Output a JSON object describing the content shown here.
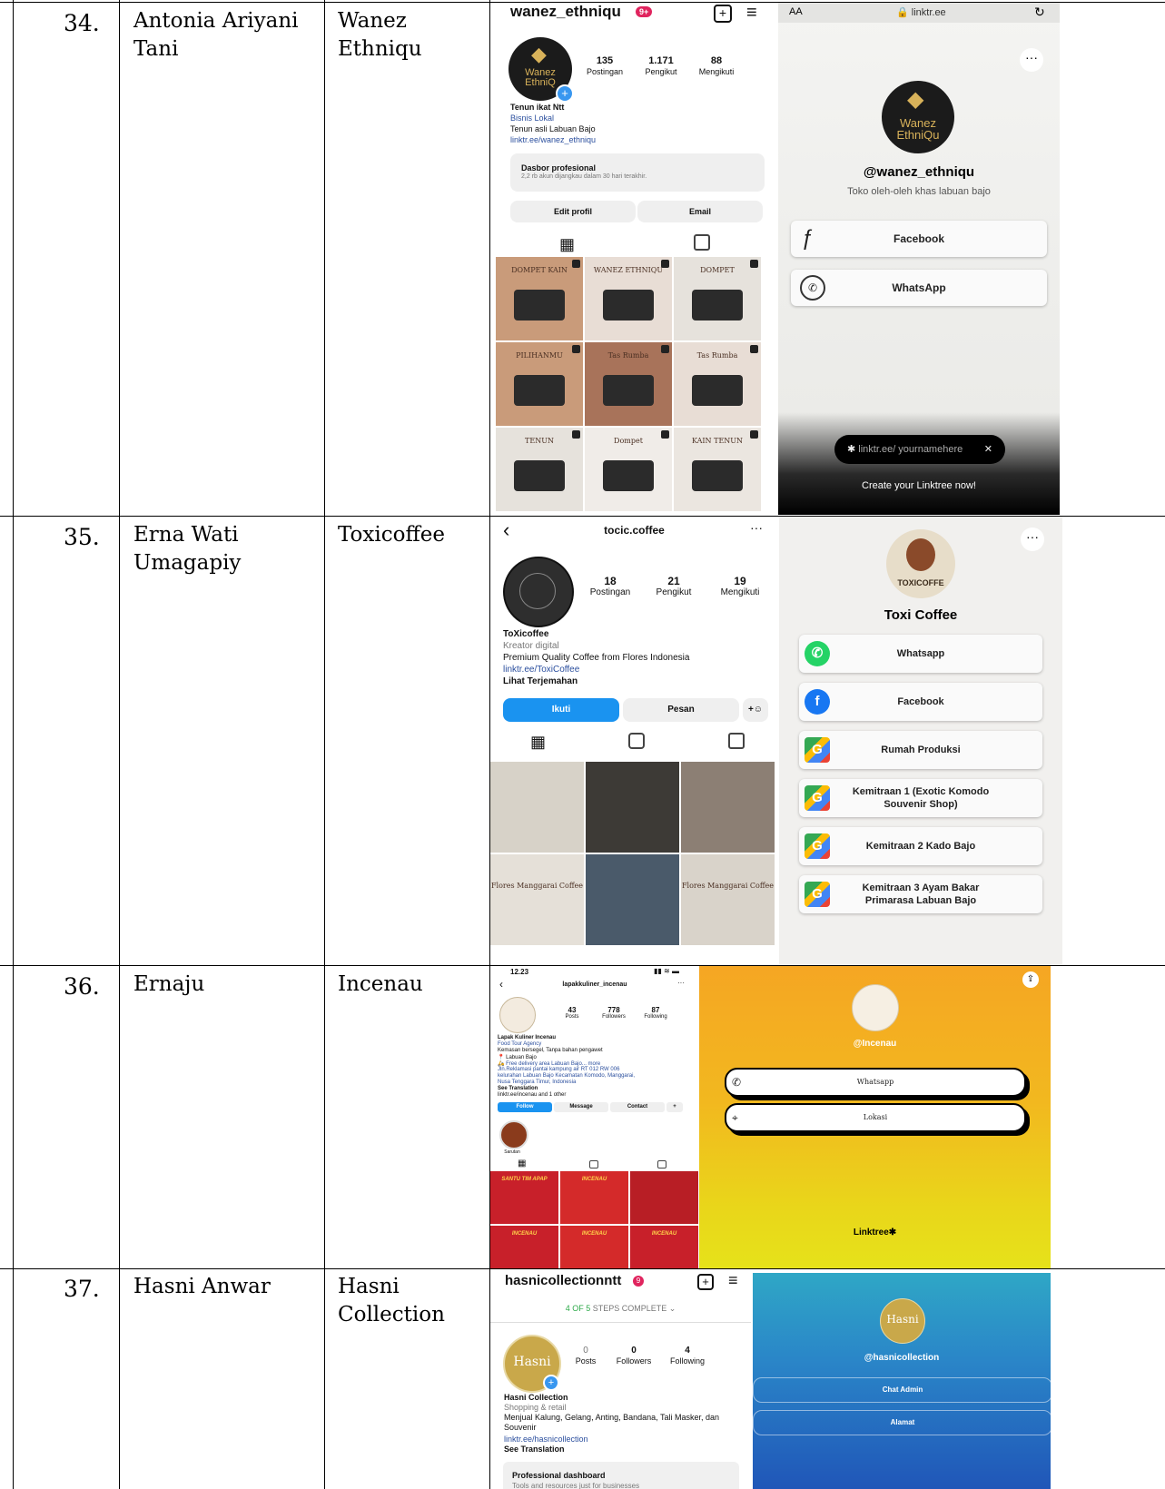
{
  "rows": [
    {
      "no": "34.",
      "name": "Antonia Ariyani\nTani",
      "business": "Wanez\nEthniqu",
      "instagram": {
        "username": "wanez_ethniqu",
        "badge": "9+",
        "posts": "135",
        "posts_label": "Postingan",
        "followers": "1.171",
        "followers_label": "Pengikut",
        "following": "88",
        "following_label": "Mengikuti",
        "logo_text": "Wanez\nEthniQ",
        "bio_name": "Tenun ikat Ntt",
        "category": "Bisnis Lokal",
        "bio": "Tenun asli Labuan Bajo",
        "link": "linktr.ee/wanez_ethniqu",
        "dash_title": "Dasbor profesional",
        "dash_sub": "2,2 rb akun dijangkau dalam 30 hari terakhir.",
        "btn1": "Edit profil",
        "btn2": "Email",
        "thumbs": [
          {
            "text": "DOMPET KAIN",
            "bg": "#c99b7a"
          },
          {
            "text": "WANEZ ETHNIQU",
            "bg": "#e8ddd5"
          },
          {
            "text": "DOMPET",
            "bg": "#e6e2dc"
          },
          {
            "text": "PILIHANMU",
            "bg": "#c99b7a"
          },
          {
            "text": "Tas Rumba",
            "bg": "#a8735a"
          },
          {
            "text": "Tas Rumba",
            "bg": "#e8ddd5"
          },
          {
            "text": "TENUN",
            "bg": "#e6e2dc"
          },
          {
            "text": "Dompet",
            "bg": "#f0ece8"
          },
          {
            "text": "KAIN TENUN",
            "bg": "#ebe6e0"
          }
        ]
      },
      "linktree": {
        "text_size": "AA",
        "url": "linktr.ee",
        "handle": "@wanez_ethniqu",
        "logo_text": "Wanez\nEthniQu",
        "desc": "Toko oleh-oleh khas labuan bajo",
        "links": [
          "Facebook",
          "WhatsApp"
        ],
        "promo": "linktr.ee/ yournamehere",
        "cta": "Create your Linktree now!"
      }
    },
    {
      "no": "35.",
      "name": "Erna Wati\nUmagapiy",
      "business": "Toxicoffee",
      "instagram": {
        "username": "tocic.coffee",
        "posts": "18",
        "posts_label": "Postingan",
        "followers": "21",
        "followers_label": "Pengikut",
        "following": "19",
        "following_label": "Mengikuti",
        "bio_name": "ToXicoffee",
        "category": "Kreator digital",
        "bio": "Premium Quality Coffee from Flores Indonesia",
        "link": "linktr.ee/ToxiCoffee",
        "translate": "Lihat Terjemahan",
        "btn1": "Ikuti",
        "btn2": "Pesan",
        "thumbs": [
          {
            "text": "",
            "bg": "#d7d2c8"
          },
          {
            "text": "",
            "bg": "#3d3a36"
          },
          {
            "text": "",
            "bg": "#8c7f74"
          },
          {
            "text": "Flores Manggarai Coffee",
            "bg": "#e5e0d8"
          },
          {
            "text": "",
            "bg": "#4a5a6a"
          },
          {
            "text": "Flores Manggarai Coffee",
            "bg": "#d9d3ca"
          }
        ]
      },
      "linktree": {
        "title": "Toxi Coffee",
        "logo_text": "TOXICOFFE",
        "links": [
          {
            "label": "Whatsapp",
            "icon": "whatsapp-icon"
          },
          {
            "label": "Facebook",
            "icon": "facebook-icon"
          },
          {
            "label": "Rumah Produksi",
            "icon": "google-maps-icon"
          },
          {
            "label": "Kemitraan 1 (Exotic Komodo\nSouvenir Shop)",
            "icon": "google-maps-icon"
          },
          {
            "label": "Kemitraan 2 Kado Bajo",
            "icon": "google-maps-icon"
          },
          {
            "label": "Kemitraan 3 Ayam Bakar\nPrimarasa Labuan Bajo",
            "icon": "google-maps-icon"
          }
        ]
      }
    },
    {
      "no": "36.",
      "name": "Ernaju",
      "business": "Incenau",
      "instagram": {
        "time": "12.23",
        "username": "lapakkuliner_incenau",
        "posts": "43",
        "posts_label": "Posts",
        "followers": "778",
        "followers_label": "Followers",
        "following": "87",
        "following_label": "Following",
        "bio_name": "Lapak Kuliner Incenau",
        "category": "Food Tour Agency",
        "bio_lines": [
          "Kemasan bersegel, Tanpa bahan pengawet",
          "📍 Labuan Bajo",
          "🛵 Free delivery area Labuan Bajo... more",
          "Jln.Reklamasi pantai kampung air RT 012 RW 006",
          "kelurahan Labuan Bajo Kecamatan Komodo, Manggarai,",
          "Nusa Tenggara Timur, Indonesia"
        ],
        "translate": "See Translation",
        "link": "linktr.ee/incenau and 1 other",
        "btn1": "Follow",
        "btn2": "Message",
        "btn3": "Contact",
        "highlight": "Sarutan",
        "thumbs": [
          {
            "text": "SANTU TIM APAP",
            "bg": "#c8202a"
          },
          {
            "text": "INCENAU",
            "bg": "#d42a2a"
          },
          {
            "text": "",
            "bg": "#b81e25"
          },
          {
            "text": "INCENAU",
            "bg": "#c8202a"
          },
          {
            "text": "INCENAU",
            "bg": "#d42a2a"
          },
          {
            "text": "INCENAU",
            "bg": "#c8202a"
          }
        ]
      },
      "linktree": {
        "handle": "@Incenau",
        "links": [
          "Whatsapp",
          "Lokasi"
        ],
        "footer": "Linktree✱"
      }
    },
    {
      "no": "37.",
      "name": "Hasni Anwar",
      "business": "Hasni\nCollection",
      "instagram": {
        "username": "hasnicollectionntt",
        "steps_prefix": "4 OF 5",
        "steps_suffix": "STEPS COMPLETE",
        "logo_text": "Hasni",
        "posts": "0",
        "posts_label": "Posts",
        "followers": "0",
        "followers_label": "Followers",
        "following": "4",
        "following_label": "Following",
        "bio_name": "Hasni Collection",
        "category": "Shopping & retail",
        "bio": "Menjual Kalung, Gelang, Anting, Bandana, Tali Masker, dan\nSouvenir",
        "link": "linktr.ee/hasnicollection",
        "translate": "See Translation",
        "dash_title": "Professional dashboard",
        "dash_sub": "Tools and resources just for businesses"
      },
      "linktree": {
        "logo_text": "Hasni",
        "handle": "@hasnicollection",
        "links": [
          "Chat Admin",
          "Alamat"
        ]
      }
    }
  ]
}
